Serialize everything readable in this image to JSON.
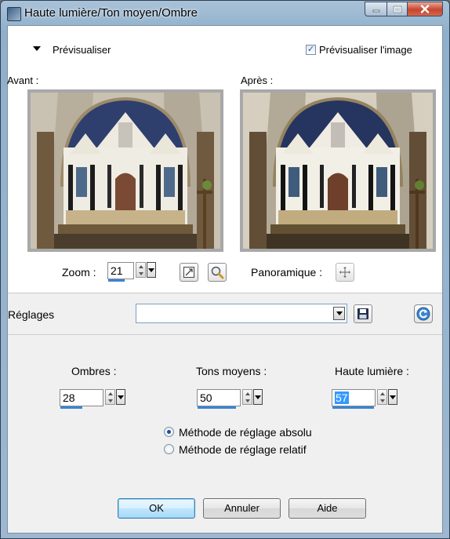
{
  "window": {
    "title": "Haute lumière/Ton moyen/Ombre"
  },
  "preview": {
    "section_label": "Prévisualiser",
    "checkbox_label": "Prévisualiser l'image",
    "checkbox_checked": true,
    "before_label": "Avant :",
    "after_label": "Après :",
    "zoom_label": "Zoom :",
    "zoom_value": "21",
    "pan_label": "Panoramique :"
  },
  "settings": {
    "label": "Réglages",
    "value": ""
  },
  "adjust": {
    "shadows": {
      "label": "Ombres :",
      "value": "28",
      "fill": 0.28
    },
    "midtones": {
      "label": "Tons moyens :",
      "value": "50",
      "fill": 0.5
    },
    "highlights": {
      "label": "Haute lumière :",
      "value": "57",
      "fill": 0.57
    },
    "method_absolute": "Méthode de réglage absolu",
    "method_relative": "Méthode de réglage relatif",
    "selected_method": "absolute"
  },
  "buttons": {
    "ok": "OK",
    "cancel": "Annuler",
    "help": "Aide"
  },
  "colors": {
    "accent": "#3a84d8",
    "selection": "#3399ff"
  }
}
